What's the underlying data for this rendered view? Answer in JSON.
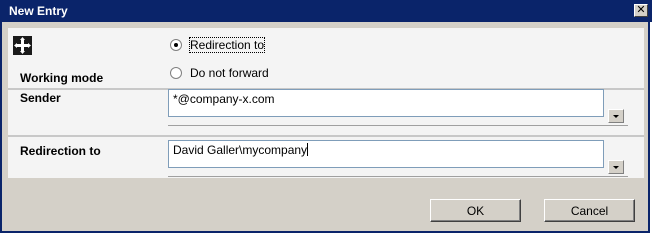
{
  "window": {
    "title": "New Entry",
    "close_icon": "close-icon"
  },
  "working_mode": {
    "label": "Working mode",
    "icon": "move-arrows-icon",
    "options": [
      {
        "label": "Redirection to",
        "selected": true
      },
      {
        "label": "Do not forward",
        "selected": false
      }
    ]
  },
  "sender": {
    "label": "Sender",
    "value": "*@company-x.com"
  },
  "redirection": {
    "label": "Redirection to",
    "value": "David Galler\\mycompany"
  },
  "buttons": {
    "ok": "OK",
    "cancel": "Cancel"
  }
}
